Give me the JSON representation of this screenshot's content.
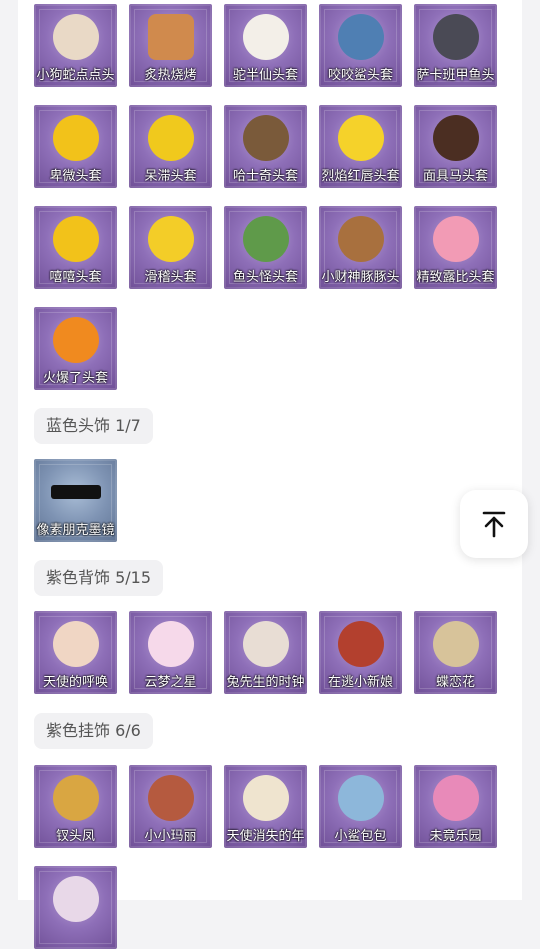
{
  "rows": [
    [
      "小狗蛇点点头",
      "炙热烧烤",
      "驼半仙头套",
      "咬咬鲨头套",
      "萨卡班甲鱼头"
    ],
    [
      "卑微头套",
      "呆滞头套",
      "哈士奇头套",
      "烈焰红唇头套",
      "面具马头套"
    ],
    [
      "嘻嘻头套",
      "滑稽头套",
      "鱼头怪头套",
      "小财神豚豚头",
      "精致露比头套"
    ],
    [
      "火爆了头套"
    ]
  ],
  "sections": {
    "blue_head": {
      "label": "蓝色头饰 1/7",
      "items": [
        "像素朋克墨镜"
      ]
    },
    "purple_back": {
      "label": "紫色背饰 5/15",
      "items": [
        "天使的呼唤",
        "云梦之星",
        "兔先生的时钟",
        "在逃小新娘",
        "蝶恋花"
      ]
    },
    "purple_hang": {
      "label": "紫色挂饰 6/6",
      "items": [
        "钗头凤",
        "小小玛丽",
        "天使消失的年",
        "小鲨包包",
        "未竟乐园"
      ]
    }
  },
  "icons": {
    "scroll_top": "arrow-up-to-top-icon"
  },
  "colors": {
    "tile_purple": "#8e6fb8",
    "tile_blue": "#7e93b3"
  }
}
